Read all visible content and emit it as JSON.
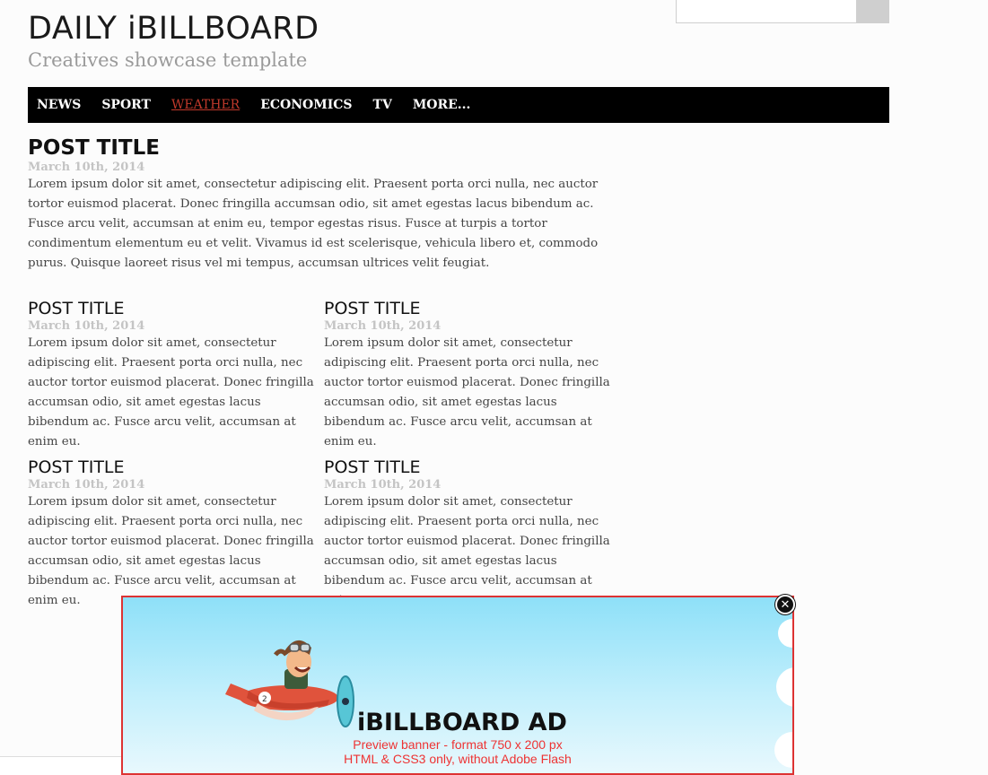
{
  "header": {
    "title": "DAILY iBILLBOARD",
    "subtitle": "Creatives showcase template"
  },
  "search": {
    "placeholder": ""
  },
  "nav": {
    "items": [
      "NEWS",
      "SPORT",
      "WEATHER",
      "ECONOMICS",
      "TV",
      "MORE..."
    ],
    "active": "WEATHER"
  },
  "featured_post": {
    "title": "POST TITLE",
    "date": "March 10th, 2014",
    "body": "Lorem ipsum dolor sit amet, consectetur adipiscing elit. Praesent porta orci nulla, nec auctor tortor euismod placerat. Donec fringilla accumsan odio, sit amet egestas lacus bibendum ac. Fusce arcu velit, accumsan at enim eu, tempor egestas risus. Fusce at turpis a tortor condimentum elementum eu et velit. Vivamus id est scelerisque, vehicula libero et, commodo purus. Quisque laoreet risus vel mi tempus, accumsan ultrices velit feugiat."
  },
  "posts": [
    {
      "title": "POST TITLE",
      "date": "March 10th, 2014",
      "body": "Lorem ipsum dolor sit amet, consectetur adipiscing elit. Praesent porta orci nulla, nec auctor tortor euismod placerat. Donec fringilla accumsan odio, sit amet egestas lacus bibendum ac. Fusce arcu velit, accumsan at enim eu."
    },
    {
      "title": "POST TITLE",
      "date": "March 10th, 2014",
      "body": "Lorem ipsum dolor sit amet, consectetur adipiscing elit. Praesent porta orci nulla, nec auctor tortor euismod placerat. Donec fringilla accumsan odio, sit amet egestas lacus bibendum ac. Fusce arcu velit, accumsan at enim eu."
    },
    {
      "title": "POST TITLE",
      "date": "March 10th, 2014",
      "body": "Lorem ipsum dolor sit amet, consectetur adipiscing elit. Praesent porta orci nulla, nec auctor tortor euismod placerat. Donec fringilla accumsan odio, sit amet egestas lacus bibendum ac. Fusce arcu velit, accumsan at enim eu."
    },
    {
      "title": "POST TITLE",
      "date": "March 10th, 2014",
      "body": "Lorem ipsum dolor sit amet, consectetur adipiscing elit. Praesent porta orci nulla, nec auctor tortor euismod placerat. Donec fringilla accumsan odio, sit amet egestas lacus bibendum ac. Fusce arcu velit, accumsan at enim eu."
    }
  ],
  "ad": {
    "title": "iBILLBOARD AD",
    "line1": "Preview banner - format 750 x 200 px",
    "line2": "HTML & CSS3 only, without Adobe Flash",
    "close_icon": "close-icon",
    "border_color": "#dd3333",
    "text_color": "#ee3333"
  },
  "colors": {
    "nav_bg": "#000000",
    "nav_active": "#c0392b",
    "date": "#c4c4c4"
  }
}
